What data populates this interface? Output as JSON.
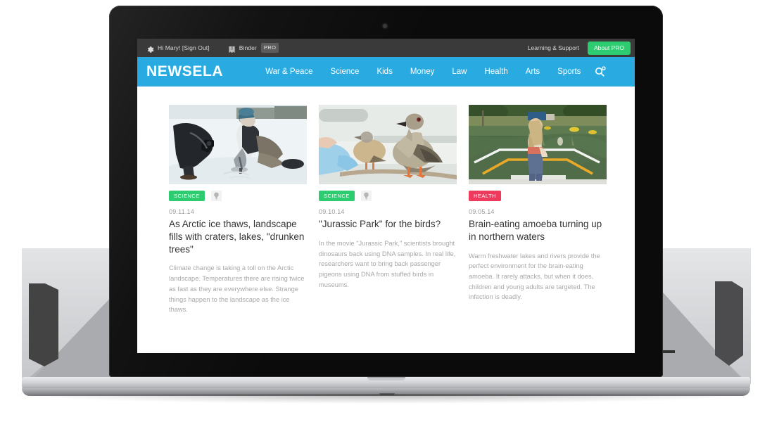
{
  "utility_bar": {
    "gear_icon": "gear-icon",
    "greeting": "Hi Mary! [Sign Out]",
    "binder_icon": "binder-icon",
    "binder_label": "Binder",
    "binder_pro_tag": "PRO",
    "learning_support": "Learning & Support",
    "about_pro": "About PRO",
    "bg_color": "#3a3a3a",
    "about_pro_color": "#2ecc71"
  },
  "navbar": {
    "brand": "NEWSELA",
    "bg_color": "#29abe2",
    "links": [
      {
        "label": "War & Peace"
      },
      {
        "label": "Science"
      },
      {
        "label": "Kids"
      },
      {
        "label": "Money"
      },
      {
        "label": "Law"
      },
      {
        "label": "Health"
      },
      {
        "label": "Arts"
      },
      {
        "label": "Sports"
      }
    ],
    "search_icon": "search-plus-icon"
  },
  "articles": [
    {
      "image_alt": "Two researchers kneeling on snow drilling into arctic ice",
      "badge": "SCIENCE",
      "badge_color": "#2ecc71",
      "has_bulb": true,
      "date": "09.11.14",
      "title": "As Arctic ice thaws, landscape fills with craters, lakes, \"drunken trees\"",
      "summary": "Climate change is taking a toll on the Arctic landscape. Temperatures there are rising twice as fast as they are everywhere else. Strange things happen to the landscape as the ice thaws."
    },
    {
      "image_alt": "Two pigeons on a perch with gloved hands in a lab",
      "badge": "SCIENCE",
      "badge_color": "#2ecc71",
      "has_bulb": true,
      "date": "09.10.14",
      "title": "\"Jurassic Park\" for the birds?",
      "summary": "In the movie \"Jurassic Park,\" scientists brought dinosaurs back using DNA samples. In real life, researchers want to bring back passenger pigeons using DNA from stuffed birds in museums."
    },
    {
      "image_alt": "Girl standing on a dock platform beside a lake",
      "badge": "HEALTH",
      "badge_color": "#ee3a5c",
      "has_bulb": false,
      "date": "09.05.14",
      "title": "Brain-eating amoeba turning up in northern waters",
      "summary": "Warm freshwater lakes and rivers provide the perfect environment for the brain-eating amoeba. It rarely attacks, but when it does, children and young adults are targeted. The infection is deadly."
    }
  ],
  "device": {
    "type": "laptop",
    "lid_color": "#0b0b0b",
    "base_color": "#c9cbce"
  },
  "background": {
    "dark_polygon_color": "#4a4a4a",
    "light_polygon_color": "#aaaaaa",
    "page_color": "#ffffff"
  }
}
